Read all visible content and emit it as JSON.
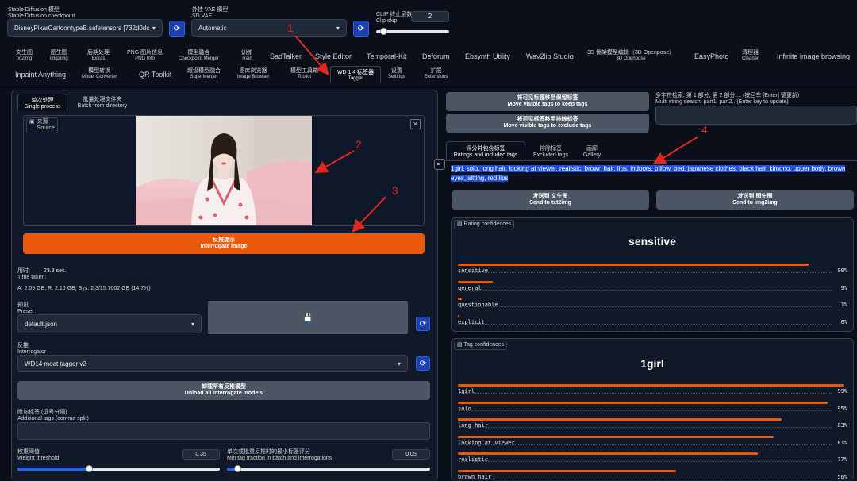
{
  "top": {
    "checkpoint_label": "Stable Diffusion 模型",
    "checkpoint_sub": "Stable Diffusion checkpoint",
    "checkpoint_value": "DisneyPixarCartoontypeB.safetensors [732d0dc",
    "vae_label": "外挂 VAE 模型",
    "vae_sub": "SD VAE",
    "vae_value": "Automatic",
    "clip_label": "CLIP 终止层数",
    "clip_sub": "Clip skip",
    "clip_value": "2",
    "clip_fraction": 0.1
  },
  "tabs_row1": [
    {
      "zh": "文生图",
      "en": "txt2img"
    },
    {
      "zh": "图生图",
      "en": "img2img"
    },
    {
      "zh": "后期处理",
      "en": "Extras"
    },
    {
      "zh": "PNG 图片信息",
      "en": "PNG Info"
    },
    {
      "zh": "模型融合",
      "en": "Checkpoint Merger"
    },
    {
      "zh": "训练",
      "en": "Train"
    },
    {
      "zh": "SadTalker",
      "en": ""
    },
    {
      "zh": "Style Editor",
      "en": ""
    },
    {
      "zh": "Temporal-Kit",
      "en": ""
    },
    {
      "zh": "Deforum",
      "en": ""
    },
    {
      "zh": "Ebsynth Utility",
      "en": ""
    },
    {
      "zh": "Wav2lip Studio",
      "en": ""
    },
    {
      "zh": "3D 骨架模型编辑（3D Openpose）",
      "en": "3D Openpose"
    },
    {
      "zh": "EasyPhoto",
      "en": ""
    },
    {
      "zh": "清理器",
      "en": "Cleaner"
    },
    {
      "zh": "Infinite image browsing",
      "en": ""
    }
  ],
  "tabs_row2": [
    {
      "zh": "Inpaint Anything",
      "en": ""
    },
    {
      "zh": "模型转换",
      "en": "Model Converter"
    },
    {
      "zh": "QR Toolkit",
      "en": ""
    },
    {
      "zh": "超级模型融合",
      "en": "SuperMerger"
    },
    {
      "zh": "图库浏览器",
      "en": "Image Browser"
    },
    {
      "zh": "模型工具箱",
      "en": "Toolkit"
    },
    {
      "zh": "WD 1.4 标签器",
      "en": "Tagger"
    },
    {
      "zh": "设置",
      "en": "Settings"
    },
    {
      "zh": "扩展",
      "en": "Extensions"
    }
  ],
  "left": {
    "subtab_single_zh": "单次处理",
    "subtab_single_en": "Single process",
    "subtab_batch_zh": "批量处理文件夹",
    "subtab_batch_en": "Batch from directory",
    "source_zh": "来源",
    "source_en": "Source",
    "close_icon": "×",
    "interrogate_zh": "反推提示",
    "interrogate_en": "Interrogate image",
    "time_zh": "用时:",
    "time_en": "Time taken:",
    "time_value": "23.3 sec.",
    "mem_line": "A: 2.09 GB, R: 2.10 GB, Sys: 2.3/15.7002 GB (14.7%)",
    "preset_zh": "预设",
    "preset_en": "Preset",
    "preset_value": "default.json",
    "save_icon": "💾",
    "interrogator_zh": "反推",
    "interrogator_en": "Interrogator",
    "interrogator_value": "WD14 moat tagger v2",
    "unload_zh": "卸载所有反推模型",
    "unload_en": "Unload all interrogate models",
    "additional_zh": "附加标签 (逗号分隔)",
    "additional_en": "Additional tags (comma split)",
    "additional_value": "",
    "weight_zh": "权重阈值",
    "weight_en": "Weight threshold",
    "weight_value": "0.35",
    "min_frac_zh": "单次或批量反推时的最小标签评分",
    "min_frac_en": "Min tag fraction in batch and interrogations",
    "min_frac_value": "0.05"
  },
  "right": {
    "keep_zh": "将可见标签移至保留标签",
    "keep_en": "Move visible tags to keep tags",
    "exclude_zh": "将可见标签移至排除标签",
    "exclude_en": "Move visible tags to exclude tags",
    "search_label_zh": "多字符检索: 第 1 部分, 第 2 部分 ... (按回车 [Enter] 键更新)",
    "search_label_en": "Multi string search: part1, part2.. (Enter key to update)",
    "collapse_icon": "⇤",
    "tab_ratings_zh": "评分并包含标签",
    "tab_ratings_en": "Ratings and included tags",
    "tab_excluded_zh": "排除标签",
    "tab_excluded_en": "Excluded tags",
    "tab_gallery_zh": "画廊",
    "tab_gallery_en": "Gallery",
    "tags_output": "1girl, solo, long hair, looking at viewer, realistic, brown hair, lips, indoors, pillow, bed, japanese clothes, black hair, kimono, upper body, brown eyes, sitting, red lips",
    "send_txt_zh": "发送到 文生图",
    "send_txt_en": "Send to txt2img",
    "send_img_zh": "发送到 图生图",
    "send_img_en": "Send to img2img",
    "rating_label": "Rating confidences",
    "rating_top": "sensitive",
    "ratings": [
      {
        "name": "sensitive",
        "value": 90,
        "pct": "90%"
      },
      {
        "name": "general",
        "value": 9,
        "pct": "9%"
      },
      {
        "name": "questionable",
        "value": 1,
        "pct": "1%"
      },
      {
        "name": "explicit",
        "value": 0,
        "pct": "0%"
      }
    ],
    "tag_label": "Tag confidences",
    "tag_top": "1girl",
    "tags": [
      {
        "name": "1girl",
        "value": 99,
        "pct": "99%"
      },
      {
        "name": "solo",
        "value": 95,
        "pct": "95%"
      },
      {
        "name": "long hair",
        "value": 83,
        "pct": "83%"
      },
      {
        "name": "looking at viewer",
        "value": 81,
        "pct": "81%"
      },
      {
        "name": "realistic",
        "value": 77,
        "pct": "77%"
      },
      {
        "name": "brown hair",
        "value": 56,
        "pct": "56%"
      }
    ]
  },
  "annotations": [
    "1",
    "2",
    "3",
    "4"
  ],
  "colors": {
    "accent": "#ea580c",
    "arrow": "#e0281e",
    "bg": "#0b0f19"
  }
}
